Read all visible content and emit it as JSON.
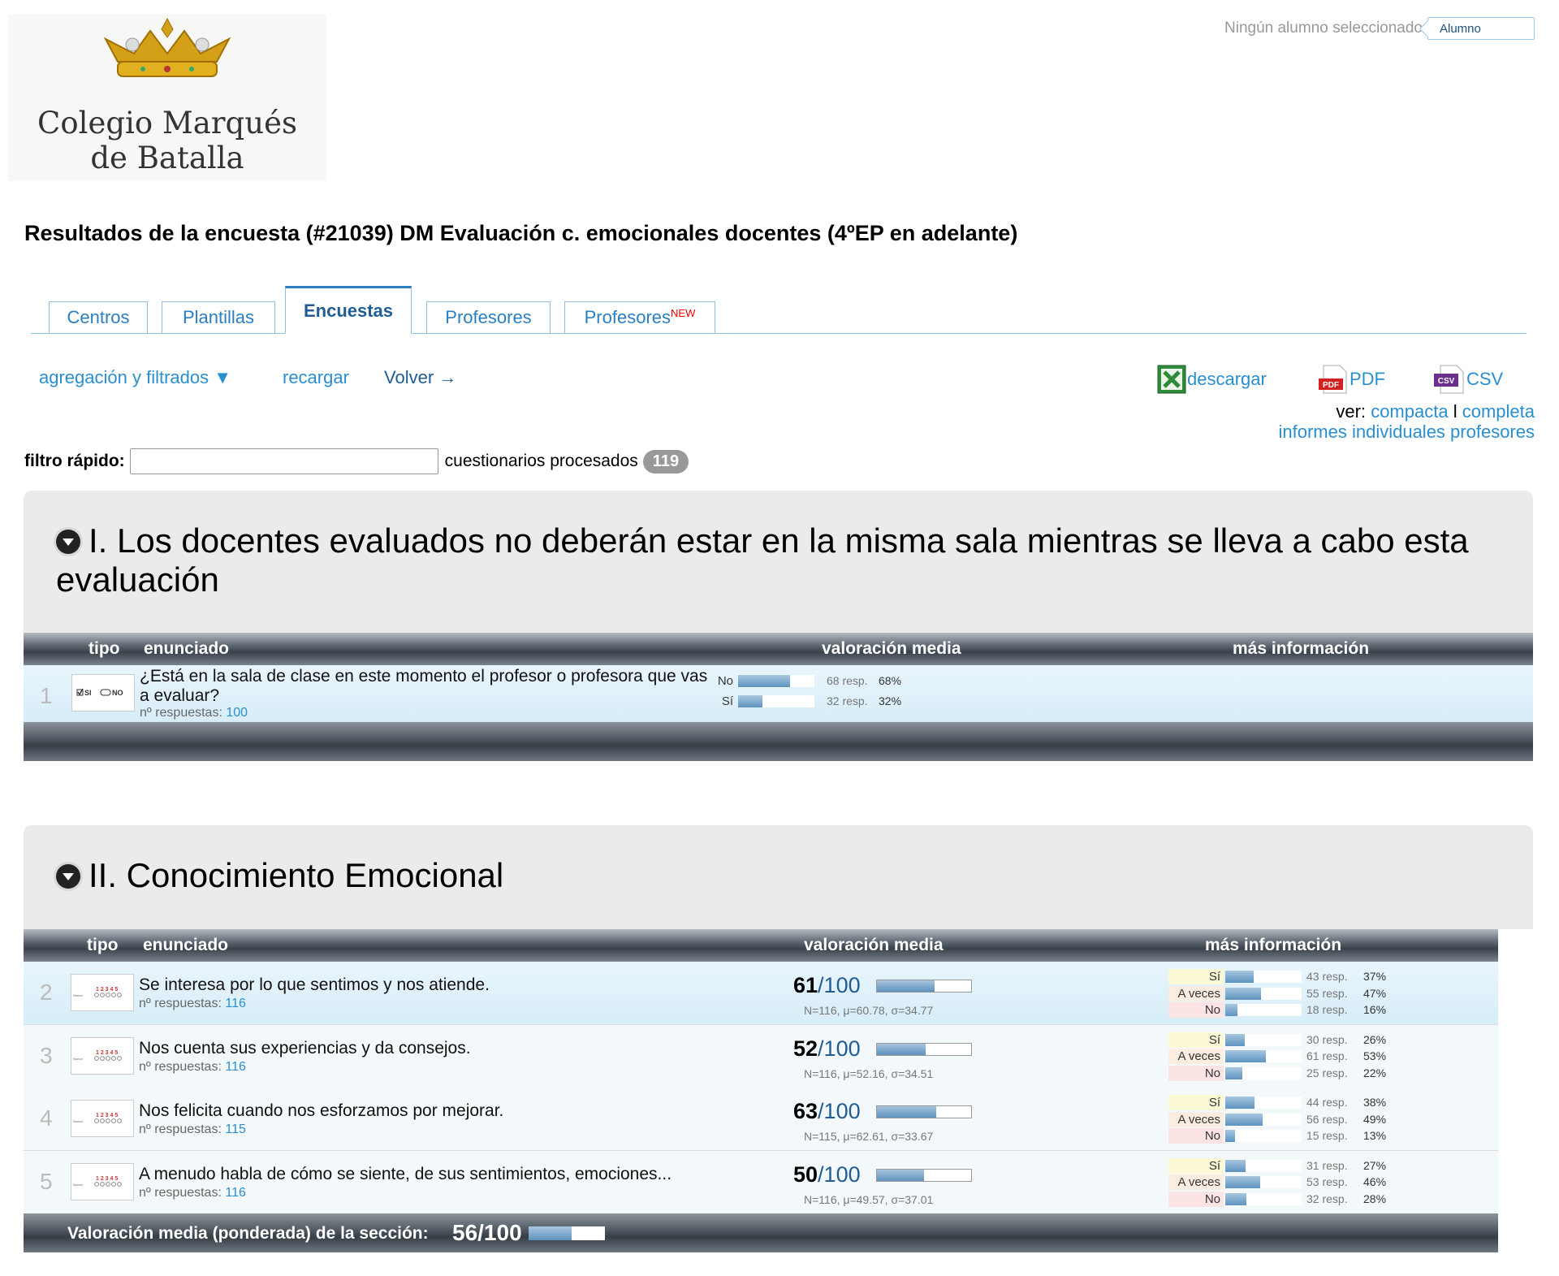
{
  "header": {
    "logo_line1": "Colegio Marqués",
    "logo_line2": "de Batalla",
    "student_status": "Ningún alumno seleccionado",
    "student_placeholder": "Alumno"
  },
  "page_title": "Resultados de la encuesta (#21039) DM Evaluación c. emocionales docentes (4ºEP en adelante)",
  "tabs": [
    {
      "label": "Centros"
    },
    {
      "label": "Plantillas"
    },
    {
      "label": "Encuestas",
      "active": true
    },
    {
      "label": "Profesores"
    },
    {
      "label": "Profesores",
      "badge": "NEW"
    }
  ],
  "toolbar": {
    "aggregation": "agregación y filtrados ▼",
    "reload": "recargar",
    "back": "Volver →",
    "download": "descargar",
    "pdf": "PDF",
    "csv": "CSV",
    "view_label": "ver:",
    "view_compact": "compacta",
    "view_separator": "l",
    "view_full": "completa",
    "individual_reports": "informes individuales profesores",
    "icon_excel": "excel-icon",
    "icon_pdf": "pdf-icon",
    "icon_csv": "csv-icon"
  },
  "quick_filter": {
    "label": "filtro rápido:",
    "value": "",
    "processed_label": "cuestionarios procesados",
    "processed_count": "119"
  },
  "table_headers": {
    "tipo": "tipo",
    "enunciado": "enunciado",
    "valoracion": "valoración media",
    "info": "más información"
  },
  "section1": {
    "title": "I. Los docentes evaluados no deberán estar en la misma sala mientras se lleva a cabo esta evaluación",
    "question": {
      "num": "1",
      "text": "¿Está en la sala de clase en este momento el profesor o profesora que vas a evaluar?",
      "responses_label": "nº respuestas:",
      "responses": "100",
      "type_icon": "yes-no-icon",
      "options": [
        {
          "label": "No",
          "count": "68 resp.",
          "percent": "68%",
          "fraction": 0.68
        },
        {
          "label": "Sí",
          "count": "32 resp.",
          "percent": "32%",
          "fraction": 0.32
        }
      ]
    }
  },
  "section2": {
    "title": "II. Conocimiento Emocional",
    "questions": [
      {
        "num": "2",
        "text": "Se interesa por lo que sentimos y nos atiende.",
        "responses_label": "nº respuestas:",
        "responses": "116",
        "score": "61",
        "score_den": "/100",
        "score_fraction": 0.61,
        "stats": "N=116, μ=60.78, σ=34.77",
        "options": [
          {
            "label": "Sí",
            "count": "43 resp.",
            "percent": "37%",
            "fraction": 0.37
          },
          {
            "label": "A veces",
            "count": "55 resp.",
            "percent": "47%",
            "fraction": 0.47
          },
          {
            "label": "No",
            "count": "18 resp.",
            "percent": "16%",
            "fraction": 0.16
          }
        ]
      },
      {
        "num": "3",
        "text": "Nos cuenta sus experiencias y da consejos.",
        "responses_label": "nº respuestas:",
        "responses": "116",
        "score": "52",
        "score_den": "/100",
        "score_fraction": 0.52,
        "stats": "N=116, μ=52.16, σ=34.51",
        "options": [
          {
            "label": "Sí",
            "count": "30 resp.",
            "percent": "26%",
            "fraction": 0.26
          },
          {
            "label": "A veces",
            "count": "61 resp.",
            "percent": "53%",
            "fraction": 0.53
          },
          {
            "label": "No",
            "count": "25 resp.",
            "percent": "22%",
            "fraction": 0.22
          }
        ]
      },
      {
        "num": "4",
        "text": "Nos felicita cuando nos esforzamos por mejorar.",
        "responses_label": "nº respuestas:",
        "responses": "115",
        "score": "63",
        "score_den": "/100",
        "score_fraction": 0.63,
        "stats": "N=115, μ=62.61, σ=33.67",
        "options": [
          {
            "label": "Sí",
            "count": "44 resp.",
            "percent": "38%",
            "fraction": 0.38
          },
          {
            "label": "A veces",
            "count": "56 resp.",
            "percent": "49%",
            "fraction": 0.49
          },
          {
            "label": "No",
            "count": "15 resp.",
            "percent": "13%",
            "fraction": 0.13
          }
        ]
      },
      {
        "num": "5",
        "text": "A menudo habla de cómo se siente, de sus sentimientos, emociones...",
        "responses_label": "nº respuestas:",
        "responses": "116",
        "score": "50",
        "score_den": "/100",
        "score_fraction": 0.5,
        "stats": "N=116, μ=49.57, σ=37.01",
        "options": [
          {
            "label": "Sí",
            "count": "31 resp.",
            "percent": "27%",
            "fraction": 0.27
          },
          {
            "label": "A veces",
            "count": "53 resp.",
            "percent": "46%",
            "fraction": 0.46
          },
          {
            "label": "No",
            "count": "32 resp.",
            "percent": "28%",
            "fraction": 0.28
          }
        ]
      }
    ],
    "footer_label": "Valoración media (ponderada) de la sección:",
    "footer_score": "56/100",
    "footer_fraction": 0.56
  },
  "colors": {
    "accent": "#2a8fcf",
    "option_yes_bg": "#fbf8d6",
    "option_sometimes_bg": "#fbeee0",
    "option_no_bg": "#fde4e4"
  }
}
